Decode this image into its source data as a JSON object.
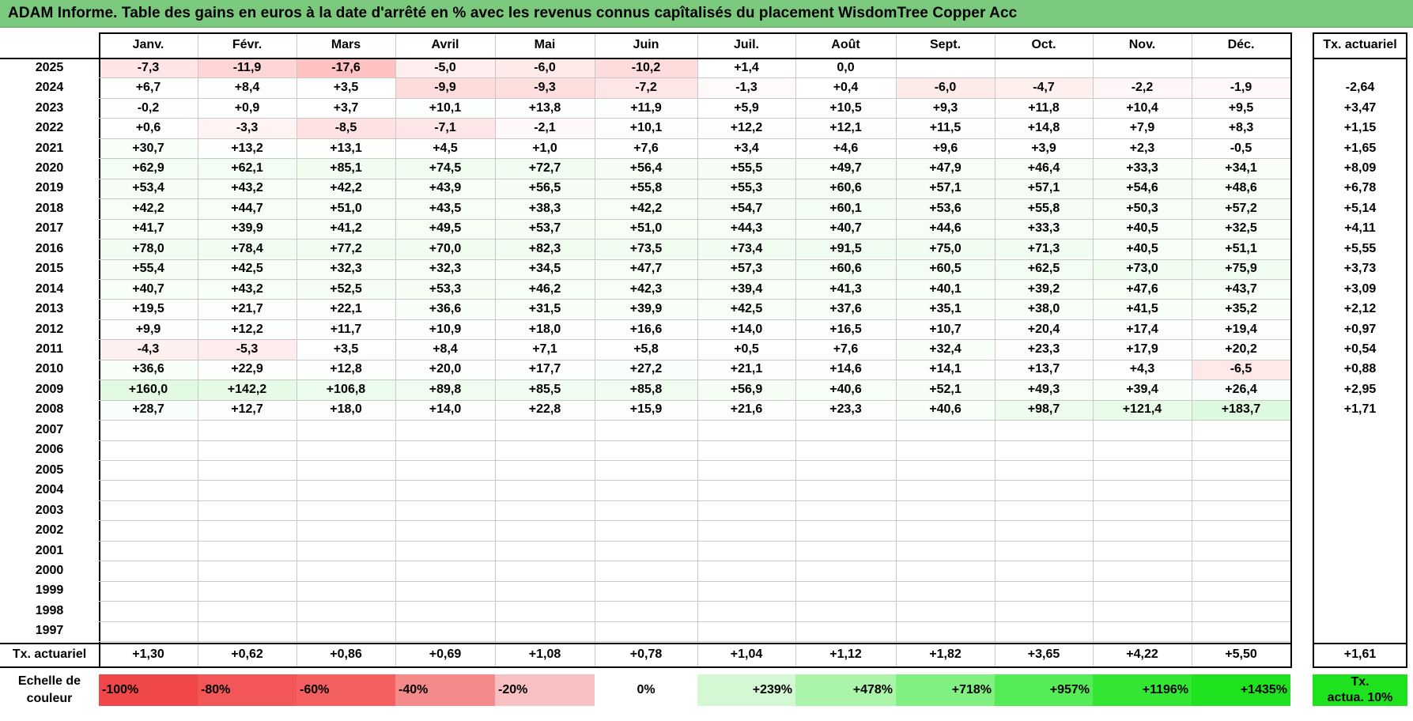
{
  "title": "ADAM Informe. Table des gains en euros à la date d'arrêté en % avec les revenus connus capîtalisés du placement WisdomTree Copper Acc",
  "months": [
    "Janv.",
    "Févr.",
    "Mars",
    "Avril",
    "Mai",
    "Juin",
    "Juil.",
    "Août",
    "Sept.",
    "Oct.",
    "Nov.",
    "Déc."
  ],
  "annual_header": "Tx. actuariel",
  "rows": [
    {
      "year": "2025",
      "values": [
        "-7,3",
        "-11,9",
        "-17,6",
        "-5,0",
        "-6,0",
        "-10,2",
        "+1,4",
        "0,0",
        "",
        "",
        "",
        ""
      ],
      "annual": ""
    },
    {
      "year": "2024",
      "values": [
        "+6,7",
        "+8,4",
        "+3,5",
        "-9,9",
        "-9,3",
        "-7,2",
        "-1,3",
        "+0,4",
        "-6,0",
        "-4,7",
        "-2,2",
        "-1,9"
      ],
      "annual": "-2,64"
    },
    {
      "year": "2023",
      "values": [
        "-0,2",
        "+0,9",
        "+3,7",
        "+10,1",
        "+13,8",
        "+11,9",
        "+5,9",
        "+10,5",
        "+9,3",
        "+11,8",
        "+10,4",
        "+9,5"
      ],
      "annual": "+3,47"
    },
    {
      "year": "2022",
      "values": [
        "+0,6",
        "-3,3",
        "-8,5",
        "-7,1",
        "-2,1",
        "+10,1",
        "+12,2",
        "+12,1",
        "+11,5",
        "+14,8",
        "+7,9",
        "+8,3"
      ],
      "annual": "+1,15"
    },
    {
      "year": "2021",
      "values": [
        "+30,7",
        "+13,2",
        "+13,1",
        "+4,5",
        "+1,0",
        "+7,6",
        "+3,4",
        "+4,6",
        "+9,6",
        "+3,9",
        "+2,3",
        "-0,5"
      ],
      "annual": "+1,65"
    },
    {
      "year": "2020",
      "values": [
        "+62,9",
        "+62,1",
        "+85,1",
        "+74,5",
        "+72,7",
        "+56,4",
        "+55,5",
        "+49,7",
        "+47,9",
        "+46,4",
        "+33,3",
        "+34,1"
      ],
      "annual": "+8,09"
    },
    {
      "year": "2019",
      "values": [
        "+53,4",
        "+43,2",
        "+42,2",
        "+43,9",
        "+56,5",
        "+55,8",
        "+55,3",
        "+60,6",
        "+57,1",
        "+57,1",
        "+54,6",
        "+48,6"
      ],
      "annual": "+6,78"
    },
    {
      "year": "2018",
      "values": [
        "+42,2",
        "+44,7",
        "+51,0",
        "+43,5",
        "+38,3",
        "+42,2",
        "+54,7",
        "+60,1",
        "+53,6",
        "+55,8",
        "+50,3",
        "+57,2"
      ],
      "annual": "+5,14"
    },
    {
      "year": "2017",
      "values": [
        "+41,7",
        "+39,9",
        "+41,2",
        "+49,5",
        "+53,7",
        "+51,0",
        "+44,3",
        "+40,7",
        "+44,6",
        "+33,3",
        "+40,5",
        "+32,5"
      ],
      "annual": "+4,11"
    },
    {
      "year": "2016",
      "values": [
        "+78,0",
        "+78,4",
        "+77,2",
        "+70,0",
        "+82,3",
        "+73,5",
        "+73,4",
        "+91,5",
        "+75,0",
        "+71,3",
        "+40,5",
        "+51,1"
      ],
      "annual": "+5,55"
    },
    {
      "year": "2015",
      "values": [
        "+55,4",
        "+42,5",
        "+32,3",
        "+32,3",
        "+34,5",
        "+47,7",
        "+57,3",
        "+60,6",
        "+60,5",
        "+62,5",
        "+73,0",
        "+75,9"
      ],
      "annual": "+3,73"
    },
    {
      "year": "2014",
      "values": [
        "+40,7",
        "+43,2",
        "+52,5",
        "+53,3",
        "+46,2",
        "+42,3",
        "+39,4",
        "+41,3",
        "+40,1",
        "+39,2",
        "+47,6",
        "+43,7"
      ],
      "annual": "+3,09"
    },
    {
      "year": "2013",
      "values": [
        "+19,5",
        "+21,7",
        "+22,1",
        "+36,6",
        "+31,5",
        "+39,9",
        "+42,5",
        "+37,6",
        "+35,1",
        "+38,0",
        "+41,5",
        "+35,2"
      ],
      "annual": "+2,12"
    },
    {
      "year": "2012",
      "values": [
        "+9,9",
        "+12,2",
        "+11,7",
        "+10,9",
        "+18,0",
        "+16,6",
        "+14,0",
        "+16,5",
        "+10,7",
        "+20,4",
        "+17,4",
        "+19,4"
      ],
      "annual": "+0,97"
    },
    {
      "year": "2011",
      "values": [
        "-4,3",
        "-5,3",
        "+3,5",
        "+8,4",
        "+7,1",
        "+5,8",
        "+0,5",
        "+7,6",
        "+32,4",
        "+23,3",
        "+17,9",
        "+20,2"
      ],
      "annual": "+0,54"
    },
    {
      "year": "2010",
      "values": [
        "+36,6",
        "+22,9",
        "+12,8",
        "+20,0",
        "+17,7",
        "+27,2",
        "+21,1",
        "+14,6",
        "+14,1",
        "+13,7",
        "+4,3",
        "-6,5"
      ],
      "annual": "+0,88"
    },
    {
      "year": "2009",
      "values": [
        "+160,0",
        "+142,2",
        "+106,8",
        "+89,8",
        "+85,5",
        "+85,8",
        "+56,9",
        "+40,6",
        "+52,1",
        "+49,3",
        "+39,4",
        "+26,4"
      ],
      "annual": "+2,95"
    },
    {
      "year": "2008",
      "values": [
        "+28,7",
        "+12,7",
        "+18,0",
        "+14,0",
        "+22,8",
        "+15,9",
        "+21,6",
        "+23,3",
        "+40,6",
        "+98,7",
        "+121,4",
        "+183,7"
      ],
      "annual": "+1,71"
    },
    {
      "year": "2007",
      "values": [
        "",
        "",
        "",
        "",
        "",
        "",
        "",
        "",
        "",
        "",
        "",
        ""
      ],
      "annual": ""
    },
    {
      "year": "2006",
      "values": [
        "",
        "",
        "",
        "",
        "",
        "",
        "",
        "",
        "",
        "",
        "",
        ""
      ],
      "annual": ""
    },
    {
      "year": "2005",
      "values": [
        "",
        "",
        "",
        "",
        "",
        "",
        "",
        "",
        "",
        "",
        "",
        ""
      ],
      "annual": ""
    },
    {
      "year": "2004",
      "values": [
        "",
        "",
        "",
        "",
        "",
        "",
        "",
        "",
        "",
        "",
        "",
        ""
      ],
      "annual": ""
    },
    {
      "year": "2003",
      "values": [
        "",
        "",
        "",
        "",
        "",
        "",
        "",
        "",
        "",
        "",
        "",
        ""
      ],
      "annual": ""
    },
    {
      "year": "2002",
      "values": [
        "",
        "",
        "",
        "",
        "",
        "",
        "",
        "",
        "",
        "",
        "",
        ""
      ],
      "annual": ""
    },
    {
      "year": "2001",
      "values": [
        "",
        "",
        "",
        "",
        "",
        "",
        "",
        "",
        "",
        "",
        "",
        ""
      ],
      "annual": ""
    },
    {
      "year": "2000",
      "values": [
        "",
        "",
        "",
        "",
        "",
        "",
        "",
        "",
        "",
        "",
        "",
        ""
      ],
      "annual": ""
    },
    {
      "year": "1999",
      "values": [
        "",
        "",
        "",
        "",
        "",
        "",
        "",
        "",
        "",
        "",
        "",
        ""
      ],
      "annual": ""
    },
    {
      "year": "1998",
      "values": [
        "",
        "",
        "",
        "",
        "",
        "",
        "",
        "",
        "",
        "",
        "",
        ""
      ],
      "annual": ""
    },
    {
      "year": "1997",
      "values": [
        "",
        "",
        "",
        "",
        "",
        "",
        "",
        "",
        "",
        "",
        "",
        ""
      ],
      "annual": ""
    }
  ],
  "footer": {
    "label": "Tx. actuariel",
    "values": [
      "+1,30",
      "+0,62",
      "+0,86",
      "+0,69",
      "+1,08",
      "+0,78",
      "+1,04",
      "+1,12",
      "+1,82",
      "+3,65",
      "+4,22",
      "+5,50"
    ],
    "annual": "+1,61"
  },
  "color_scale": {
    "label_line1": "Echelle de",
    "label_line2": "couleur",
    "stops": [
      {
        "text": "-100%",
        "color": "#f04848",
        "align": "left"
      },
      {
        "text": "-80%",
        "color": "#f25656",
        "align": "left"
      },
      {
        "text": "-60%",
        "color": "#f46060",
        "align": "left"
      },
      {
        "text": "-40%",
        "color": "#f58a8a",
        "align": "left"
      },
      {
        "text": "-20%",
        "color": "#f8c0c0",
        "align": "left"
      },
      {
        "text": "0%",
        "color": "#ffffff",
        "align": "center"
      },
      {
        "text": "+239%",
        "color": "#d4f8d4",
        "align": "right"
      },
      {
        "text": "+478%",
        "color": "#aaf5aa",
        "align": "right"
      },
      {
        "text": "+718%",
        "color": "#80f080",
        "align": "right"
      },
      {
        "text": "+957%",
        "color": "#55ec55",
        "align": "right"
      },
      {
        "text": "+1196%",
        "color": "#33e633",
        "align": "right"
      },
      {
        "text": "+1435%",
        "color": "#1fe21f",
        "align": "right"
      }
    ],
    "annual_label_line1": "Tx.",
    "annual_label_line2": "actua. 10%",
    "annual_color": "#1fe21f"
  },
  "colors": {
    "title_bg": "#7bc97d",
    "negative": "#f04848",
    "positive": "#1fe21f"
  }
}
